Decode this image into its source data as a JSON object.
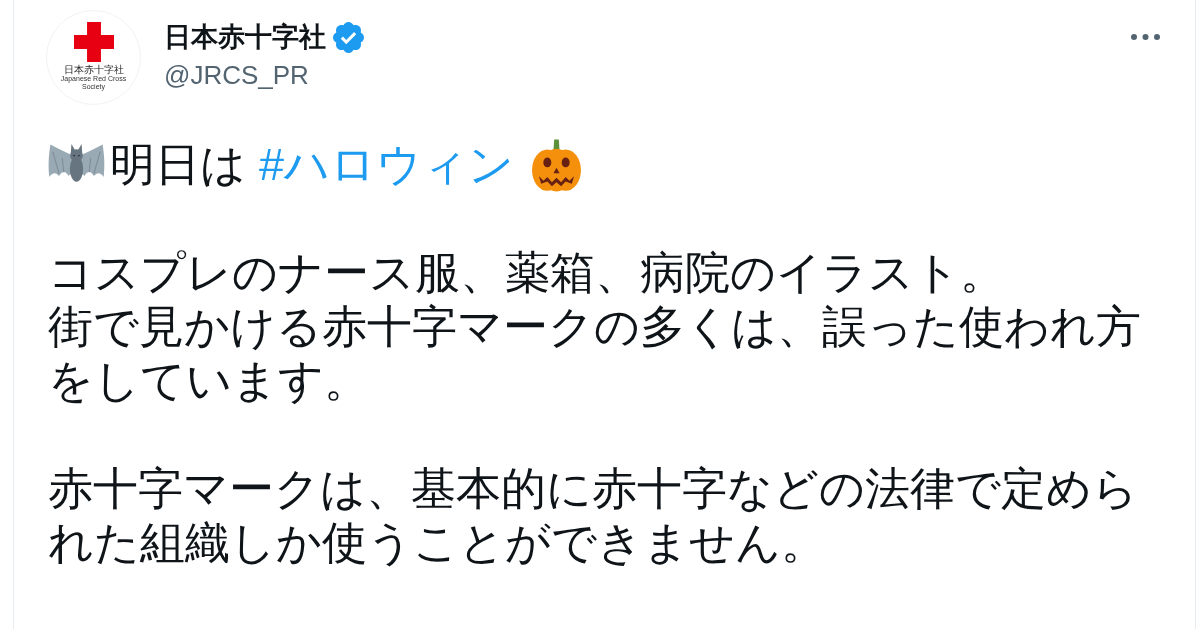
{
  "tweet": {
    "author": {
      "avatar": {
        "logo_text": "日本赤十字社",
        "logo_subtext": "Japanese Red Cross Society"
      },
      "name": "日本赤十字社",
      "verified": true,
      "handle": "@JRCS_PR"
    },
    "headline": {
      "text": "明日は",
      "hashtag": "#ハロウィン"
    },
    "paragraphs": [
      {
        "lines": [
          "コスプレのナース服、薬箱、病院のイラスト。",
          "街で見かける赤十字マークの多くは、誤った使われ方",
          "をしています。"
        ]
      },
      {
        "lines": [
          "赤十字マークは、基本的に赤十字などの法律で定めら",
          "れた組織しか使うことができません。"
        ]
      }
    ]
  }
}
